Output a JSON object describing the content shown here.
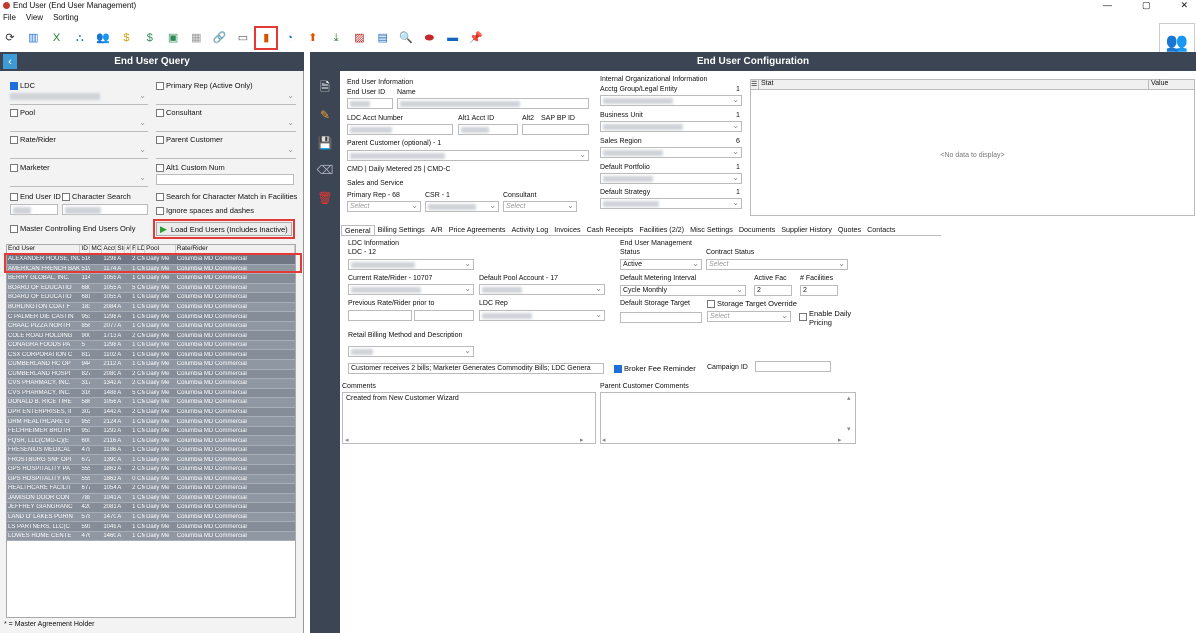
{
  "window": {
    "title": "End User (End User Management)",
    "controls": [
      "—",
      "▢",
      "✕"
    ]
  },
  "menu": [
    "File",
    "View",
    "Sorting"
  ],
  "toolbar_icons": [
    {
      "name": "refresh-icon",
      "glyph": "⟳",
      "color": "#333"
    },
    {
      "name": "panel-icon",
      "glyph": "▥",
      "color": "#1e6fd9"
    },
    {
      "name": "excel-icon",
      "glyph": "X",
      "color": "#1e7e34"
    },
    {
      "name": "org-chart-icon",
      "glyph": "⛬",
      "color": "#2a7ab8"
    },
    {
      "name": "group-icon",
      "glyph": "👥",
      "color": "#c47d14"
    },
    {
      "name": "invoice-icon",
      "glyph": "$",
      "color": "#d4a017"
    },
    {
      "name": "money-icon",
      "glyph": "$",
      "color": "#2e8b57"
    },
    {
      "name": "bookmark-icon",
      "glyph": "▣",
      "color": "#2e8b57"
    },
    {
      "name": "calendar-grid-icon",
      "glyph": "▦",
      "color": "#999"
    },
    {
      "name": "link-icon",
      "glyph": "🔗",
      "color": "#555"
    },
    {
      "name": "id-card-icon",
      "glyph": "▭",
      "color": "#555"
    },
    {
      "name": "building-icon",
      "glyph": "▮",
      "color": "#d35400"
    },
    {
      "name": "flame-icon",
      "glyph": "◔",
      "color": "#1565c0"
    },
    {
      "name": "up-arrow-icon",
      "glyph": "⬆",
      "color": "#e65100"
    },
    {
      "name": "person-money-icon",
      "glyph": "⤓",
      "color": "#2e7d32"
    },
    {
      "name": "picture-icon",
      "glyph": "▨",
      "color": "#b71c1c"
    },
    {
      "name": "calendar-icon",
      "glyph": "▤",
      "color": "#1565c0"
    },
    {
      "name": "zoom-icon",
      "glyph": "🔍",
      "color": "#1565c0"
    },
    {
      "name": "toggle-icon",
      "glyph": "⬬",
      "color": "#c62828"
    },
    {
      "name": "card-icon",
      "glyph": "▬",
      "color": "#1565c0"
    },
    {
      "name": "pin-icon",
      "glyph": "📌",
      "color": "#c62828"
    }
  ],
  "query": {
    "title": "End User Query",
    "ldc_label": "LDC",
    "primary_rep_label": "Primary Rep (Active Only)",
    "pool_label": "Pool",
    "consultant_label": "Consultant",
    "rate_rider_label": "Rate/Rider",
    "parent_customer_label": "Parent Customer",
    "marketer_label": "Marketer",
    "alt1_label": "Alt1 Custom Num",
    "end_user_id_label": "End User ID",
    "char_search_label": "Character Search",
    "char_match_label": "Search for Character Match in Facilities",
    "ignore_spaces_label": "Ignore spaces and dashes",
    "master_label": "Master Controlling End Users Only",
    "load_label": "Load End Users (Includes Inactive)",
    "legend": "* = Master Agreement Holder"
  },
  "grid": {
    "headers": [
      "End User",
      "ID",
      "MC",
      "Acct",
      "Ste",
      "#",
      "F",
      "LD",
      "Pool",
      "Rate/Rider"
    ],
    "rows": [
      [
        "ALEXANDER HOUSE, INC.",
        "5163",
        "",
        "1298",
        "A",
        "",
        "2",
        "CM",
        "Daily Me",
        "Columbia MD Commercial"
      ],
      [
        "AMERICAN FRENCH BAKE",
        "5198",
        "",
        "1174",
        "A",
        "",
        "1",
        "CM",
        "Daily Me",
        "Columbia MD Commercial"
      ],
      [
        "BERRY GLOBAL, INC.",
        "1141",
        "",
        "1055",
        "A",
        "",
        "1",
        "CM",
        "Daily Me",
        "Columbia MD Commercial"
      ],
      [
        "BOARD OF EDUCATIO",
        "680",
        "",
        "1055",
        "A",
        "",
        "5",
        "CM",
        "Daily Me",
        "Columbia MD Commercial"
      ],
      [
        "BOARD OF EDUCATIO",
        "681",
        "",
        "1055",
        "A",
        "",
        "17",
        "CM",
        "Daily Me",
        "Columbia MD Commercial"
      ],
      [
        "BURLINGTON COAT F",
        "1838",
        "",
        "2084",
        "A",
        "",
        "1",
        "CM",
        "Daily Me",
        "Columbia MD Commercial"
      ],
      [
        "C PALMER DIE CASTIN",
        "953",
        "",
        "1298",
        "A",
        "",
        "1",
        "CM",
        "Daily Me",
        "Columbia MD Commercial"
      ],
      [
        "CHAAC PIZZA NORTH",
        "8565",
        "",
        "2077",
        "A",
        "",
        "1",
        "CM",
        "Daily Me",
        "Columbia MD Commercial"
      ],
      [
        "COLE ROAD HOLDING",
        "9009",
        "",
        "1713",
        "A",
        "",
        "2",
        "CM",
        "Daily Me",
        "Columbia MD Commercial"
      ],
      [
        "CONAGRA FOODS PA",
        "5",
        "",
        "1298",
        "A",
        "",
        "1",
        "CM",
        "Daily Me",
        "Columbia MD Commercial"
      ],
      [
        "CSX CORPORATION C",
        "812",
        "",
        "1102",
        "A",
        "",
        "1",
        "CM",
        "Daily Me",
        "Columbia MD Commercial"
      ],
      [
        "CUMBERLAND HC OP",
        "9447",
        "",
        "2112",
        "A",
        "",
        "1",
        "CM",
        "Daily Me",
        "Columbia MD Commercial"
      ],
      [
        "CUMBERLAND HOSPI",
        "8277",
        "",
        "2080",
        "A",
        "",
        "2",
        "CM",
        "Daily Me",
        "Columbia MD Commercial"
      ],
      [
        "CVS PHARMACY, INC.",
        "317",
        "",
        "1342",
        "A",
        "",
        "2",
        "CM",
        "Daily Me",
        "Columbia MD Commercial"
      ],
      [
        "CVS PHARMACY, INC.",
        "316",
        "",
        "1488",
        "A",
        "",
        "5",
        "CM",
        "Daily Me",
        "Columbia MD Commercial"
      ],
      [
        "DONALD B. RICE TIRE",
        "5866",
        "",
        "1056",
        "A",
        "",
        "1",
        "CM",
        "Daily Me",
        "Columbia MD Commercial"
      ],
      [
        "DPR ENTERPRISES, II",
        "3023",
        "",
        "1442",
        "A",
        "",
        "2",
        "CM",
        "Daily Me",
        "Columbia MD Commercial"
      ],
      [
        "DRM HEALTHCARE O",
        "9557",
        "",
        "2124",
        "A",
        "",
        "1",
        "CM",
        "Daily Me",
        "Columbia MD Commercial"
      ],
      [
        "FECHHEIMER BROTH",
        "953",
        "",
        "1292",
        "A",
        "",
        "1",
        "CM",
        "Daily Me",
        "Columbia MD Commercial"
      ],
      [
        "FQSR, LLC(CMD-C)(E",
        "6000",
        "",
        "2116",
        "A",
        "",
        "1",
        "CM",
        "Daily Me",
        "Columbia MD Commercial"
      ],
      [
        "FRESENIUS MEDICAL",
        "4786",
        "",
        "1186",
        "A",
        "",
        "1",
        "CM",
        "Daily Me",
        "Columbia MD Commercial"
      ],
      [
        "FROSTBURG SNF OPI",
        "6720",
        "",
        "1390",
        "A",
        "",
        "1",
        "CM",
        "Daily Me",
        "Columbia MD Commercial"
      ],
      [
        "GPS HOSPITALITY PA",
        "5555",
        "",
        "1863",
        "A",
        "",
        "2",
        "CM",
        "Daily Me",
        "Columbia MD Commercial"
      ],
      [
        "GPS HOSPITALITY PA",
        "555A",
        "",
        "1863",
        "A",
        "",
        "0",
        "CM",
        "Daily Me",
        "Columbia MD Commercial"
      ],
      [
        "HEALTHCARE FACILIT",
        "6777",
        "",
        "1054",
        "A",
        "",
        "2",
        "CM",
        "Daily Me",
        "Columbia MD Commercial"
      ],
      [
        "JAMISON DOOR CON",
        "7887",
        "",
        "1041",
        "A",
        "",
        "1",
        "CM",
        "Daily Me",
        "Columbia MD Commercial"
      ],
      [
        "JEFFREY GIANGRANC",
        "4209",
        "",
        "2081",
        "A",
        "",
        "1",
        "CM",
        "Daily Me",
        "Columbia MD Commercial"
      ],
      [
        "LAND O' LAKES PURIN",
        "578",
        "",
        "1470",
        "A",
        "",
        "1",
        "CM",
        "Daily Me",
        "Columbia MD Commercial"
      ],
      [
        "LS PARTNERS, LLC(C",
        "5910",
        "",
        "1049",
        "A",
        "",
        "1",
        "CM",
        "Daily Me",
        "Columbia MD Commercial"
      ],
      [
        "LOWES HOME CENTE",
        "476",
        "",
        "1460",
        "A",
        "",
        "1",
        "CM",
        "Daily Me",
        "Columbia MD Commercial"
      ]
    ]
  },
  "config": {
    "title": "End User Configuration",
    "eu_info_label": "End User Information",
    "eu_id_label": "End User ID",
    "name_label": "Name",
    "ldc_acct_label": "LDC Acct Number",
    "alt1_acct_label": "Alt1 Acct ID",
    "alt2_label": "Alt2",
    "sap_label": "SAP BP ID",
    "parent_cust_label": "Parent Customer (optional) - 1",
    "cmd_text": "CMD | Daily Metered 25 | CMD-C",
    "sales_label": "Sales and Service",
    "primary_rep_label": "Primary Rep - 68",
    "csr_label": "CSR - 1",
    "consultant_label": "Consultant",
    "select_placeholder": "Select",
    "org_info_label": "Internal Organizational Information",
    "acctg_label": "Acctg Group/Legal Entity",
    "acctg_count": "1",
    "bu_label": "Business Unit",
    "bu_count": "1",
    "sales_region_label": "Sales Region",
    "sales_region_count": "6",
    "portfolio_label": "Default Portfolio",
    "portfolio_count": "1",
    "strategy_label": "Default Strategy",
    "strategy_count": "1",
    "stat_header": "Stat",
    "value_header": "Value",
    "no_data": "<No data to display>"
  },
  "tabs": [
    "General",
    "Billing Settings",
    "A/R",
    "Price Agreements",
    "Activity Log",
    "Invoices",
    "Cash Receipts",
    "Facilities (2/2)",
    "Misc Settings",
    "Documents",
    "Supplier History",
    "Quotes",
    "Contacts"
  ],
  "general": {
    "ldc_info_label": "LDC Information",
    "ldc_label": "LDC - 12",
    "current_rate_label": "Current Rate/Rider - 10707",
    "default_pool_label": "Default Pool Account - 17",
    "prev_rate_label": "Previous Rate/Rider prior to",
    "ldc_rep_label": "LDC Rep",
    "eum_label": "End User Management",
    "status_label": "Status",
    "status_value": "Active",
    "contract_status_label": "Contract Status",
    "metering_label": "Default Metering Interval",
    "metering_value": "Cycle Monthly",
    "active_fac_label": "Active Fac",
    "active_fac_value": "2",
    "num_fac_label": "# Facilities",
    "num_fac_value": "2",
    "storage_target_label": "Default Storage Target",
    "storage_override_label": "Storage Target Override",
    "enable_daily_label": "Enable Daily Pricing",
    "billing_method_label": "Retail Billing Method and Description",
    "billing_desc": "Customer receives 2 bills; Marketer Generates Commodity Bills; LDC Genera",
    "broker_fee_label": "Broker Fee Reminder",
    "campaign_label": "Campaign ID",
    "comments_label": "Comments",
    "comments_value": "Created from New Customer Wizard",
    "parent_comments_label": "Parent Customer Comments"
  }
}
